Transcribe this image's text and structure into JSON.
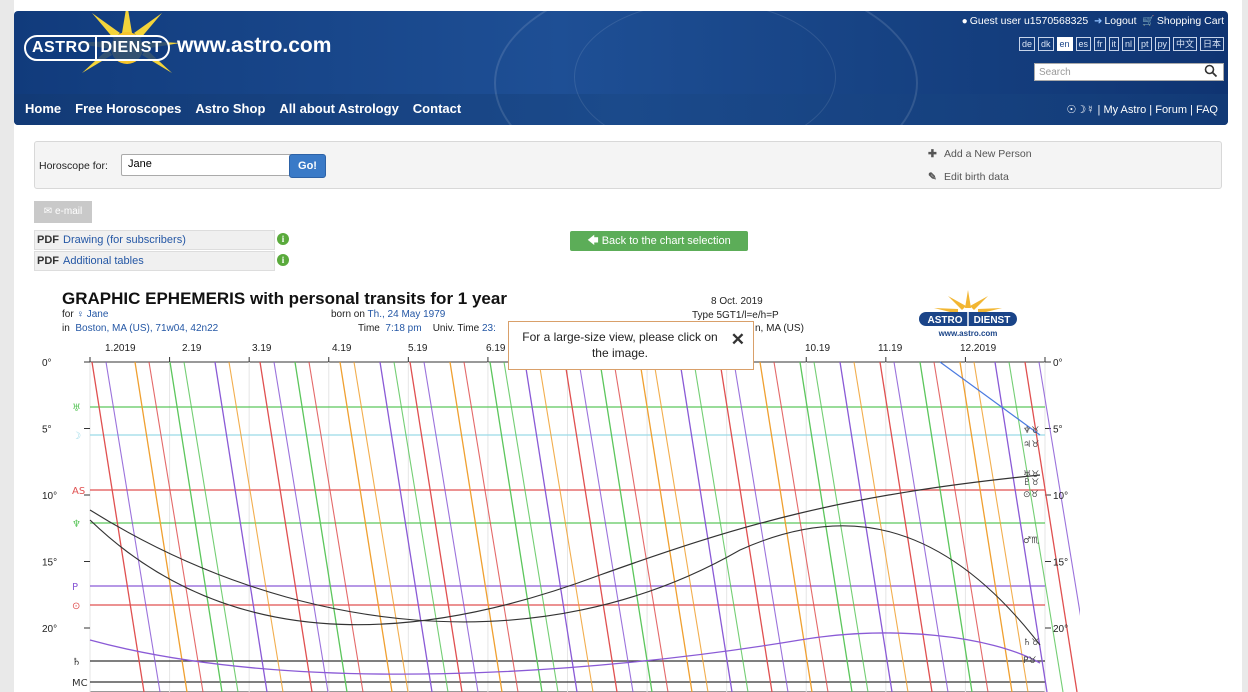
{
  "header": {
    "logo": {
      "left": "ASTRO",
      "right": "DIENST"
    },
    "site_url": "www.astro.com",
    "user": "Guest user u1570568325",
    "logout": "Logout",
    "cart": "Shopping Cart",
    "languages": [
      "de",
      "dk",
      "en",
      "es",
      "fr",
      "it",
      "nl",
      "pt",
      "ру",
      "中文",
      "日本"
    ],
    "active_language": "en",
    "search_placeholder": "Search"
  },
  "nav": {
    "items": [
      "Home",
      "Free Horoscopes",
      "Astro Shop",
      "All about Astrology",
      "Contact"
    ],
    "right_symbols": "☉☽☿",
    "right_links": [
      "My Astro",
      "Forum",
      "FAQ"
    ]
  },
  "selector": {
    "label": "Horoscope for:",
    "value": "Jane",
    "go": "Go!",
    "add_person": "Add a New Person",
    "edit_birth": "Edit birth data"
  },
  "tools": {
    "email": "e-mail",
    "pdf_prefix": "PDF",
    "pdf_drawing": "Drawing (for subscribers)",
    "pdf_tables": "Additional tables",
    "back": "Back to the chart selection"
  },
  "ephemeris": {
    "title": "GRAPHIC EPHEMERIS with personal transits for 1 year",
    "for_label": "for",
    "name": "Jane",
    "born_label": "born on",
    "born_date": "Th., 24 May 1979",
    "in_label": "in",
    "place": "Boston, MA (US), 71w04, 42n22",
    "time_label": "Time",
    "time": "7:18 pm",
    "ut_label": "Univ. Time",
    "ut": "23:",
    "date": "8 Oct. 2019",
    "type": "Type 5GT1/l=e/h=P",
    "place_partial": "n, MA (US)",
    "badge_url": "www.astro.com",
    "months": [
      "1.2019",
      "2.19",
      "3.19",
      "4.19",
      "5.19",
      "6.19",
      "10.19",
      "11.19",
      "12.2019"
    ],
    "degree_labels": [
      "0°",
      "5°",
      "10°",
      "15°",
      "20°"
    ],
    "left_points": [
      "♅",
      "☽",
      "AS",
      "♆",
      "P",
      "⊙",
      "♄",
      "MC"
    ],
    "right_symbols": [
      "♆♉",
      "♃♉",
      "♅♉",
      "♇♉",
      "⊙♉",
      "♂♏",
      "♄♉",
      "P♉"
    ]
  },
  "tooltip": {
    "text": "For a large-size view, please click on the image."
  },
  "colors": {
    "header_blue": "#1a4488",
    "go_blue": "#3a7ac7",
    "back_green": "#5cad58",
    "link_blue": "#2457a5",
    "tooltip_border": "#d9a06a"
  }
}
